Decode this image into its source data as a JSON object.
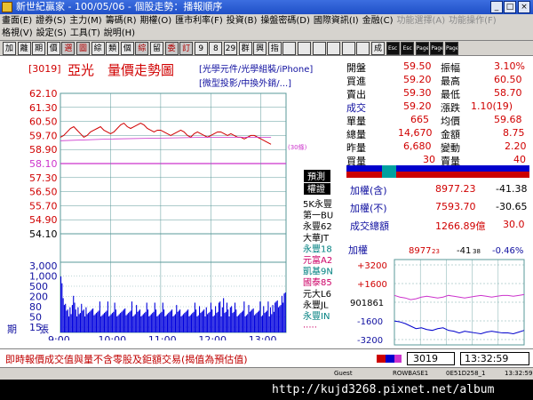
{
  "window": {
    "title": "新世紀贏家 - 100/05/06 - 個股走勢：播報順序"
  },
  "menu": {
    "row1": [
      "畫面(E)",
      "證券(S)",
      "主力(M)",
      "籌碼(R)",
      "期權(O)",
      "匯市利率(F)",
      "投資(B)",
      "操盤密碼(D)",
      "國際資訊(I)",
      "金融(C)",
      "功能選擇(A)",
      "功能操作(F)"
    ],
    "row2": [
      "格視(V)",
      "設定(S)",
      "工具(T)",
      "說明(H)"
    ]
  },
  "toolbar": {
    "buttons": [
      "加",
      "離",
      "期",
      "價",
      "選",
      "圖",
      "綜",
      "類",
      "個",
      "綜",
      "留",
      "委",
      "訂",
      "9",
      "8",
      "29",
      "群",
      "興",
      "指",
      "",
      "",
      "",
      "",
      "",
      "",
      "成",
      "Esc",
      "Esc",
      "Page Up",
      "Page Down",
      "Page"
    ]
  },
  "stock": {
    "code": "[3019]",
    "name": "亞光",
    "chart_title": "量價走勢圖",
    "concepts_line1": "[光學元件/光學組裝/iPhone]",
    "concepts_line2": "[微型投影/中換外銷/...]"
  },
  "chart_labels": {
    "ref_tag": "(30條)",
    "forecast_tab": "預測",
    "broker_tab": "權證"
  },
  "brokers": [
    {
      "name": "5K永豐",
      "color": "#000000"
    },
    {
      "name": "第一BU",
      "color": "#000000"
    },
    {
      "name": "永豐62",
      "color": "#000000"
    },
    {
      "name": "大華JT",
      "color": "#000000"
    },
    {
      "name": "永豐18",
      "color": "#008080"
    },
    {
      "name": "元富A2",
      "color": "#cc0066"
    },
    {
      "name": "凱基9N",
      "color": "#008080"
    },
    {
      "name": "國泰85",
      "color": "#cc0066"
    },
    {
      "name": "元大L6",
      "color": "#000000"
    },
    {
      "name": "永豐JL",
      "color": "#000000"
    },
    {
      "name": "永豐IN",
      "color": "#008080"
    },
    {
      "name": "·····",
      "color": "#cc0066"
    }
  ],
  "quote": {
    "open_label": "開盤",
    "open": "59.50",
    "amp_label": "振幅",
    "amp": "3.10%",
    "bid_label": "買進",
    "bid": "59.20",
    "high_label": "最高",
    "high": "60.50",
    "ask_label": "賣出",
    "ask": "59.30",
    "low_label": "最低",
    "low": "58.70",
    "deal_label": "成交",
    "deal": "59.20",
    "chg_label": "漲跌",
    "chg": "1.10(19)",
    "single_label": "單量",
    "single": "665",
    "avg_label": "均價",
    "avg": "59.68",
    "total_label": "總量",
    "total": "14,670",
    "amount_label": "金額",
    "amount": "8.75",
    "yest_label": "昨量",
    "yest": "6,680",
    "vchg_label": "變動",
    "vchg": "2.20",
    "buyq_label": "買量",
    "buyq": "30",
    "sellq_label": "賣量",
    "sellq": "40"
  },
  "index": {
    "incl_label": "加權(含)",
    "incl_value": "8977.23",
    "incl_change": "-41.38",
    "excl_label": "加權(不)",
    "excl_value": "7593.70",
    "excl_change": "-30.65",
    "turnover_label": "成交總額",
    "turnover_value": "1266.89億",
    "turnover_change": "30.0"
  },
  "mini_chart": {
    "label": "加權",
    "value": "8977",
    "value_sub": "23",
    "change": "-41",
    "change_sub": "38",
    "pct": "-0.46%",
    "y_labels": [
      "+3200",
      "+1600",
      "901861",
      "-1600",
      "-3200"
    ]
  },
  "footer": {
    "disclaimer": "即時報價成交值與量不含零股及鉅額交易(揭值為預估值)",
    "code": "3019",
    "time": "13:32:59"
  },
  "statusline": {
    "user": "Guest",
    "server": "ROWBASE1",
    "conn": "0E51D258_1",
    "clock": "13:32:59"
  },
  "taskbar": {
    "url": "http://kujd3268.pixnet.net/album"
  },
  "colors": {
    "price_line": "#d00000",
    "avg_line": "#cc33cc",
    "volume_bar": "#0000dd",
    "grid": "#5a9898"
  },
  "chart_data": {
    "type": "line",
    "title": "量價走勢圖",
    "x_ticks": [
      "9:00",
      "10:00",
      "11:00",
      "12:00",
      "13:00"
    ],
    "price_ticks": [
      "62.10",
      "61.30",
      "60.50",
      "59.70",
      "58.90",
      "58.10",
      "57.30",
      "56.50",
      "55.70",
      "54.90",
      "54.10"
    ],
    "volume_ticks": [
      "3,000",
      "1,000",
      "500",
      "200",
      "80",
      "50",
      "15"
    ],
    "volume_label_a": "期",
    "volume_label_b": "張",
    "reference_price": 58.1,
    "ylim": [
      54.1,
      62.1
    ],
    "price_series": [
      [
        0,
        59.6
      ],
      [
        4,
        59.7
      ],
      [
        8,
        59.9
      ],
      [
        12,
        60.1
      ],
      [
        16,
        60.2
      ],
      [
        20,
        60.0
      ],
      [
        24,
        59.8
      ],
      [
        28,
        59.6
      ],
      [
        32,
        59.7
      ],
      [
        36,
        59.9
      ],
      [
        40,
        60.0
      ],
      [
        44,
        60.1
      ],
      [
        48,
        60.2
      ],
      [
        52,
        60.0
      ],
      [
        56,
        59.9
      ],
      [
        60,
        59.8
      ],
      [
        64,
        59.9
      ],
      [
        68,
        60.1
      ],
      [
        72,
        60.3
      ],
      [
        76,
        60.4
      ],
      [
        80,
        60.2
      ],
      [
        84,
        60.1
      ],
      [
        88,
        60.2
      ],
      [
        92,
        60.3
      ],
      [
        96,
        60.4
      ],
      [
        100,
        60.3
      ],
      [
        104,
        60.1
      ],
      [
        108,
        60.0
      ],
      [
        112,
        59.9
      ],
      [
        116,
        60.0
      ],
      [
        120,
        60.0
      ],
      [
        124,
        59.9
      ],
      [
        128,
        59.8
      ],
      [
        132,
        59.7
      ],
      [
        136,
        59.8
      ],
      [
        140,
        59.9
      ],
      [
        144,
        60.0
      ],
      [
        148,
        59.9
      ],
      [
        152,
        59.7
      ],
      [
        156,
        59.6
      ],
      [
        160,
        59.8
      ],
      [
        164,
        59.9
      ],
      [
        168,
        59.8
      ],
      [
        172,
        59.7
      ],
      [
        176,
        59.6
      ],
      [
        180,
        59.7
      ],
      [
        184,
        59.8
      ],
      [
        188,
        59.9
      ],
      [
        192,
        59.9
      ],
      [
        196,
        59.8
      ],
      [
        200,
        59.7
      ],
      [
        204,
        59.8
      ],
      [
        208,
        59.7
      ],
      [
        212,
        59.6
      ],
      [
        216,
        59.6
      ],
      [
        220,
        59.5
      ],
      [
        224,
        59.6
      ],
      [
        228,
        59.7
      ],
      [
        232,
        59.7
      ],
      [
        236,
        59.6
      ],
      [
        240,
        59.5
      ],
      [
        244,
        59.4
      ],
      [
        248,
        59.3
      ],
      [
        252,
        59.2
      ]
    ],
    "avg_series": [
      [
        0,
        59.4
      ],
      [
        60,
        59.5
      ],
      [
        120,
        59.55
      ],
      [
        180,
        59.6
      ],
      [
        252,
        59.6
      ]
    ],
    "volume_series": [
      7,
      6,
      4,
      3,
      3,
      2,
      2,
      2,
      3,
      2,
      3,
      4,
      3,
      2,
      2,
      3,
      2,
      2,
      3,
      2,
      2,
      2,
      3,
      2,
      2,
      2,
      2,
      2,
      3,
      2,
      2,
      2,
      2,
      2,
      3,
      2,
      2,
      2,
      2,
      2,
      2,
      3,
      2,
      2,
      2,
      2,
      2,
      3,
      2,
      2,
      2,
      2,
      2,
      2,
      2,
      2,
      3,
      2,
      2,
      2,
      2,
      2,
      3,
      2,
      2,
      2,
      3,
      2,
      2,
      2,
      2,
      2,
      2,
      2,
      2,
      3,
      2,
      2,
      2,
      2,
      2,
      2,
      3,
      2,
      2,
      2,
      2,
      2,
      2,
      3,
      2,
      2,
      2,
      2,
      2,
      2,
      2,
      2,
      2,
      2,
      2,
      3,
      2,
      2,
      2,
      2,
      2,
      2,
      2,
      2,
      2,
      2,
      2,
      2,
      2,
      2,
      2,
      3,
      2,
      2,
      2,
      3,
      2,
      2,
      2,
      2,
      2,
      3,
      2,
      2,
      2,
      3,
      2,
      2,
      2,
      3,
      2,
      2,
      3,
      3,
      2,
      3,
      4,
      2,
      2,
      3,
      2,
      2,
      3,
      3,
      2,
      2,
      3,
      2,
      2,
      2,
      2,
      2,
      2,
      2,
      3,
      2,
      2,
      2,
      3,
      2,
      2,
      2,
      3,
      2,
      2,
      2,
      2,
      2,
      3,
      2,
      2,
      3,
      2,
      2,
      2,
      3,
      2,
      3,
      2,
      3,
      2,
      3,
      3,
      4,
      3,
      3,
      3,
      4,
      3,
      4,
      5
    ],
    "mini_series": [
      {
        "name": "upper",
        "color": "#cc33cc",
        "values": [
          0.42,
          0.44,
          0.45,
          0.47,
          0.46,
          0.44,
          0.43,
          0.44,
          0.45,
          0.44,
          0.42,
          0.43,
          0.44,
          0.45,
          0.44,
          0.43,
          0.42,
          0.43,
          0.44,
          0.43,
          0.42,
          0.42,
          0.43,
          0.42,
          0.41
        ]
      },
      {
        "name": "lower",
        "color": "#0000cc",
        "values": [
          0.72,
          0.73,
          0.75,
          0.78,
          0.81,
          0.8,
          0.82,
          0.83,
          0.81,
          0.8,
          0.83,
          0.84,
          0.86,
          0.84,
          0.85,
          0.86,
          0.87,
          0.85,
          0.84,
          0.85,
          0.86,
          0.86,
          0.87,
          0.85,
          0.83
        ]
      }
    ]
  }
}
